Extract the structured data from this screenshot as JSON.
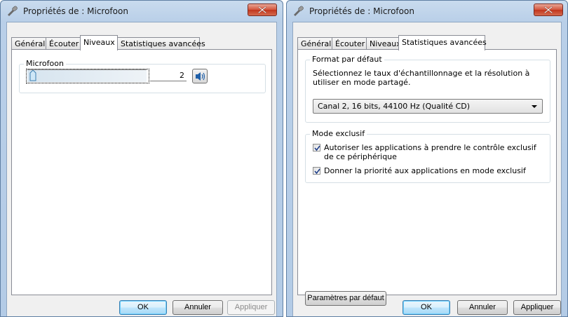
{
  "window_left": {
    "title": "Propriétés de : Microfoon",
    "tabs": [
      "Général",
      "Écouter",
      "Niveaux",
      "Statistiques avancées"
    ],
    "active_tab": "Niveaux",
    "level_group": {
      "title": "Microfoon",
      "value": "2",
      "slider_level_percent": 2
    },
    "buttons": {
      "ok": "OK",
      "cancel": "Annuler",
      "apply": "Appliquer"
    }
  },
  "window_right": {
    "title": "Propriétés de : Microfoon",
    "tabs": [
      "Général",
      "Écouter",
      "Niveaux",
      "Statistiques avancées"
    ],
    "active_tab": "Statistiques avancées",
    "default_format": {
      "title": "Format par défaut",
      "description": "Sélectionnez le taux d'échantillonnage et la résolution à utiliser en mode partagé.",
      "selected": "Canal 2, 16 bits, 44100 Hz (Qualité CD)"
    },
    "exclusive_mode": {
      "title": "Mode exclusif",
      "options": [
        {
          "label": "Autoriser les applications à prendre le contrôle exclusif de ce périphérique",
          "checked": true
        },
        {
          "label": "Donner la priorité aux applications en mode exclusif",
          "checked": true
        }
      ]
    },
    "restore_defaults": "Paramètres par défaut",
    "buttons": {
      "ok": "OK",
      "cancel": "Annuler",
      "apply": "Appliquer"
    }
  },
  "colors": {
    "accent": "#3c7fb1",
    "close": "#c7422a",
    "frame": "#b9cfe8"
  },
  "icons": {
    "app": "microphone-icon",
    "close": "close-icon",
    "speaker": "speaker-icon",
    "check": "check-icon"
  }
}
